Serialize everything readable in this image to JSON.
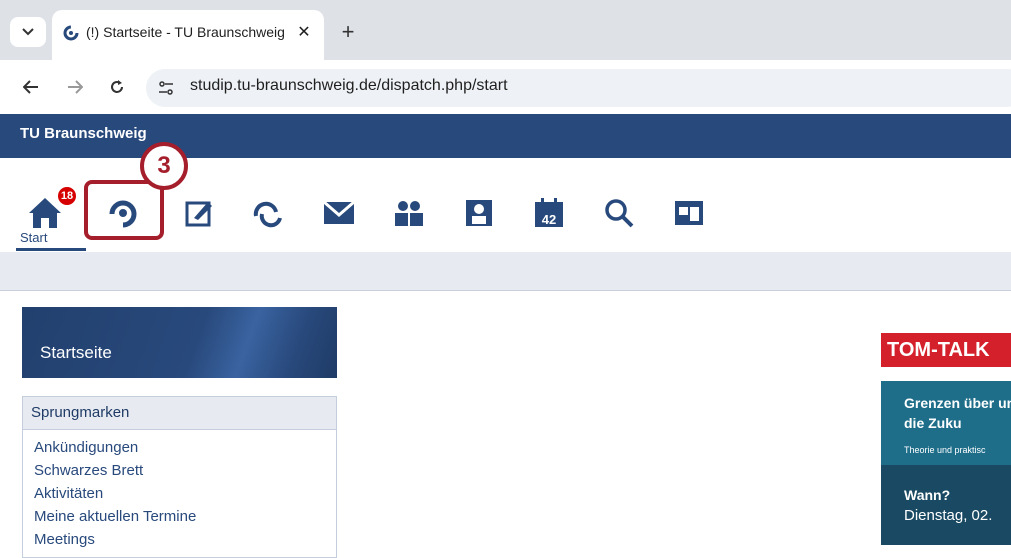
{
  "browser": {
    "tab_title": "(!) Startseite - TU Braunschweig",
    "tab_close": "✕",
    "new_tab": "+",
    "url": "studip.tu-braunschweig.de/dispatch.php/start"
  },
  "header": {
    "title": "TU Braunschweig"
  },
  "navigation": {
    "start_label": "Start",
    "badge_count": "18",
    "icons": [
      "home-icon",
      "meine-veranstaltungen-icon",
      "arbeitsplatz-icon",
      "community-icon",
      "messages-icon",
      "contacts-icon",
      "profile-icon",
      "calendar-icon",
      "search-icon",
      "tools-icon"
    ]
  },
  "annotation": {
    "step_number": "3"
  },
  "sidebar": {
    "title": "Startseite",
    "jump_title": "Sprungmarken",
    "links": [
      "Ankündigungen",
      "Schwarzes Brett",
      "Aktivitäten",
      "Meine aktuellen Termine",
      "Meetings"
    ]
  },
  "ad": {
    "label": "TOM-TALK",
    "headline": "Grenzen über und die Zuku",
    "subline": "Theorie und praktisc",
    "when_label": "Wann?",
    "date": "Dienstag, 02."
  },
  "colors": {
    "header": "#28497c",
    "highlight": "#a41e2b",
    "badge": "#d60000"
  }
}
